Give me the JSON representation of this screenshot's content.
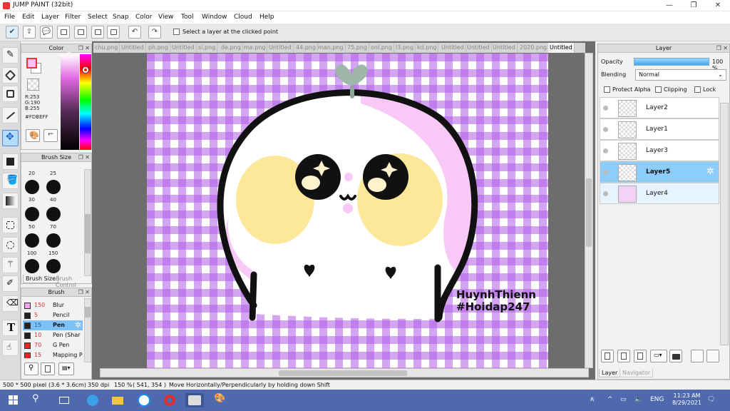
{
  "window": {
    "title": "JUMP PAINT (32bit)"
  },
  "menu": [
    "File",
    "Edit",
    "Layer",
    "Filter",
    "Select",
    "Snap",
    "Color",
    "View",
    "Tool",
    "Window",
    "Cloud",
    "Help"
  ],
  "toolbar": {
    "select_layer_label": "Select a layer at the clicked point"
  },
  "color_panel": {
    "title": "Color",
    "r": "R:253",
    "g": "G:190",
    "b": "B:255",
    "hex": "#FDBEFF",
    "fg": "#fdbeff"
  },
  "brush_size": {
    "title": "Brush Size",
    "sizes": [
      "20",
      "25",
      "30",
      "40",
      "50",
      "70",
      "100",
      "150"
    ],
    "tab_active": "Brush Size",
    "tab_other": "Brush Control"
  },
  "brush": {
    "title": "Brush",
    "items": [
      {
        "size": "150",
        "name": "Blur",
        "color": "#f2a6f0"
      },
      {
        "size": "5",
        "name": "Pencil",
        "color": "#222222"
      },
      {
        "size": "15",
        "name": "Pen",
        "color": "#222222"
      },
      {
        "size": "10",
        "name": "Pen (Shar",
        "color": "#222222"
      },
      {
        "size": "70",
        "name": "G Pen",
        "color": "#e22222"
      },
      {
        "size": "15",
        "name": "Mapping P",
        "color": "#e22222"
      }
    ]
  },
  "doc_tabs": [
    "chu.png",
    "Untitled",
    "ph.png",
    "Untitled",
    "si.png",
    "de.png",
    "ma.png",
    "Untitled",
    "44.png",
    "man.png",
    "75.png",
    "onl.png",
    "l3.png",
    "kd.png",
    "Untitled",
    "Untitled",
    "Untitled",
    "2020.png",
    "Untitled"
  ],
  "canvas": {
    "watermark_line1": "HuynhThienn",
    "watermark_line2": "#Hoidap247"
  },
  "layer_panel": {
    "title": "Layer",
    "opacity_label": "Opacity",
    "opacity_value": "100 %",
    "opacity_fraction": 1.0,
    "blending_label": "Blending",
    "blending_value": "Normal",
    "protect_alpha": "Protect Alpha",
    "clipping": "Clipping",
    "lock": "Lock",
    "layers": [
      "Layer2",
      "Layer1",
      "Layer3",
      "Layer5",
      "Layer4"
    ],
    "tab_layer": "Layer",
    "tab_navigator": "Navigator"
  },
  "status": {
    "size": "500 * 500 pixel",
    "physical": "(3.6 * 3.6cm)",
    "dpi": "350 dpi",
    "zoom": "150 %",
    "coords": "( 541, 354 )",
    "hint": "Move Horizontally/Perpendicularly by holding down Shift"
  },
  "taskbar": {
    "lang": "ENG",
    "time": "11:23 AM",
    "date": "8/29/2021"
  }
}
